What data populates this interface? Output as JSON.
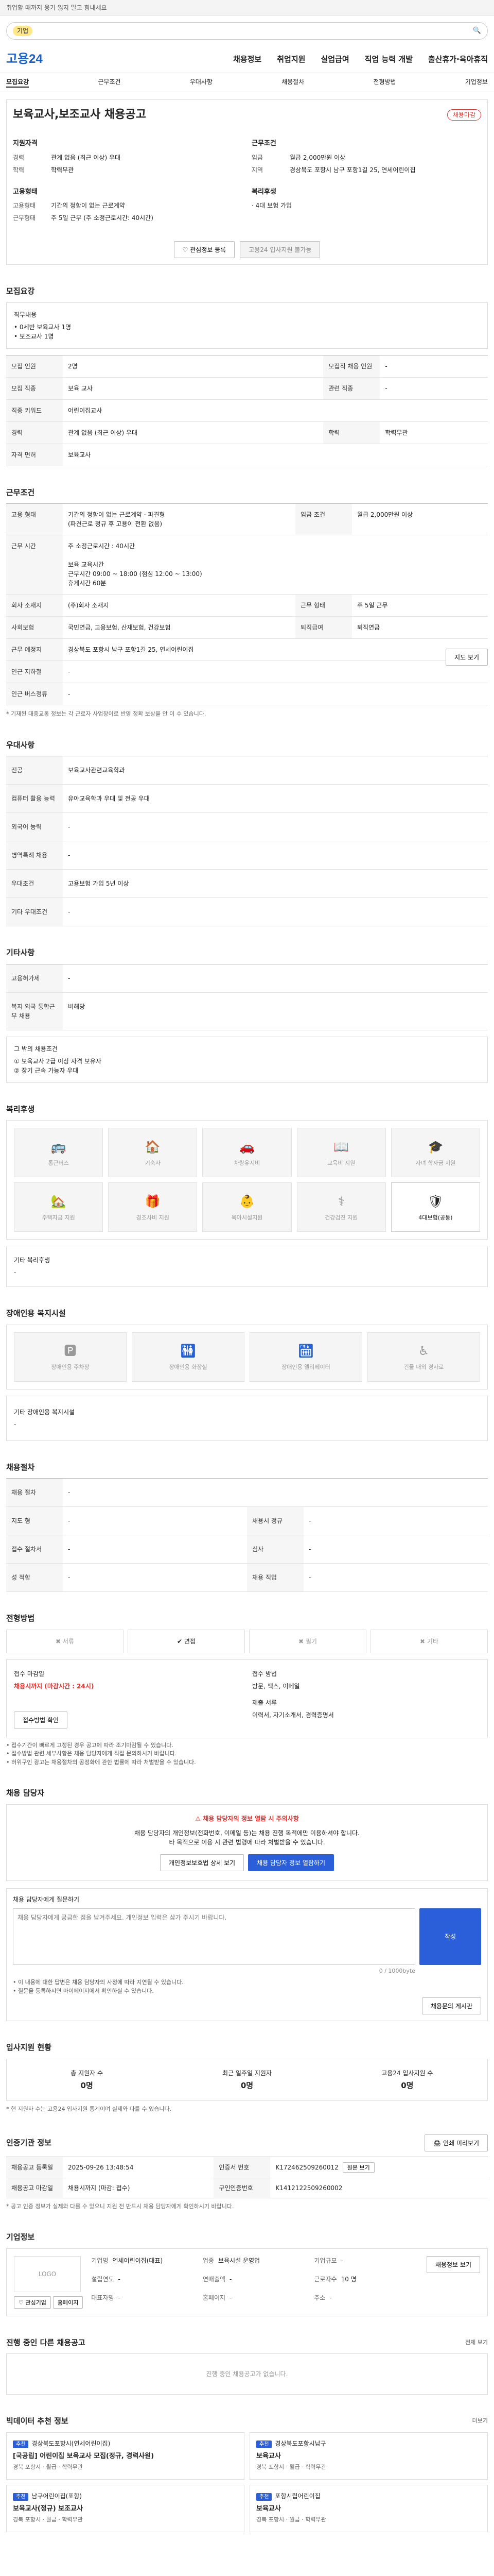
{
  "notice": "취업할 때까지 용기 잃지 말고 힘내세요",
  "search": {
    "tag": "기업",
    "placeholder": ""
  },
  "logo": "고용24",
  "gnb": [
    "채용정보",
    "취업지원",
    "실업급여",
    "직업 능력 개발",
    "출산휴가·육아휴직"
  ],
  "tabs": [
    "모집요강",
    "근무조건",
    "우대사항",
    "채용절차",
    "전형방법",
    "기업정보"
  ],
  "summary": {
    "title": "보육교사,보조교사 채용공고",
    "badge": "채용마감",
    "recruit_heading": "지원자격",
    "work_heading": "근무조건",
    "recruit_rows": [
      {
        "k": "경력",
        "v": "관계 없음 (최근 이상) 우대"
      },
      {
        "k": "학력",
        "v": "학력무관"
      }
    ],
    "work_rows": [
      {
        "k": "임금",
        "v": "월급 2,000만원 이상"
      },
      {
        "k": "지역",
        "v": "경상북도 포항시 남구 포항1길 25, 연세어린이집"
      }
    ],
    "form_heading": "고용형태",
    "form_rows": [
      {
        "k": "고용형태",
        "v": "기간의 정함이 없는 근로계약"
      },
      {
        "k": "근무형태",
        "v": "주 5일 근무 (주 소정근로시간: 40시간)"
      }
    ],
    "welfare_heading": "복리후생",
    "welfare_value": "· 4대 보험 가입",
    "interest_button": "관심정보 등록",
    "apply_button": "고용24 입사지원 불가능"
  },
  "recruit": {
    "title": "모집요강",
    "duty_label": "직무내용",
    "duties": [
      "• 0세반 보육교사 1명",
      "• 보조교사 1명"
    ],
    "rows": [
      {
        "k": "모집 인원",
        "v": "2명",
        "k2": "모집직 채용 인원",
        "v2": "-"
      },
      {
        "k": "모집 직종",
        "v": "보육 교사",
        "k2": "관련 직종",
        "v2": "-"
      },
      {
        "k": "직종 키워드",
        "v": "어린이집교사",
        "k2": "",
        "v2": ""
      },
      {
        "k": "경력",
        "v": "관계 없음 (최근 이상) 우대",
        "k2": "학력",
        "v2": "학력무관"
      },
      {
        "k": "자격 면허",
        "v": "보육교사",
        "k2": "",
        "v2": ""
      }
    ]
  },
  "work": {
    "title": "근무조건",
    "rows": [
      {
        "k": "고용 형태",
        "v": "기간의 정함이 없는 근로계약 · 파견형\n(파견근로 정규 후 고용이 전환 없음)",
        "k2": "임금 조건",
        "v2": "월급 2,000만원 이상"
      },
      {
        "k": "근무 시간",
        "v": "주 소정근로시간 : 40시간\n\n보육 교육시간\n근무시간 09:00 ~ 18:00 (점심 12:00 ~ 13:00)\n휴게시간 60분",
        "k2": "",
        "v2": ""
      },
      {
        "k": "회사 소재지",
        "v": "(주)회사 소재지",
        "k2": "근무 형태",
        "v2": "주 5일 근무"
      },
      {
        "k": "사회보험",
        "v": "국민연금, 고용보험, 산재보험, 건강보험",
        "k2": "퇴직급여",
        "v2": "퇴직연금"
      },
      {
        "k": "근무 예정지",
        "v": "경상북도 포항시 남구 포항1길 25, 연세어린이집",
        "k2": "",
        "v2": ""
      },
      {
        "k": "인근 지하철",
        "v": "-",
        "k2": "",
        "v2": ""
      },
      {
        "k": "인근 버스정류",
        "v": "-",
        "k2": "",
        "v2": ""
      }
    ],
    "map_button": "지도 보기",
    "note": "* 기재된 대중교통 정보는 각 근로자 사업장이로 반영 정확 보상을 안 이 수 있습니다."
  },
  "pref": {
    "title": "우대사항",
    "rows": [
      {
        "k": "전공",
        "v": "보육교사관련교육학과"
      },
      {
        "k": "컴퓨터 활용 능력",
        "v": "유아교육학과 우대 및 전공 우대"
      },
      {
        "k": "외국어 능력",
        "v": "-"
      },
      {
        "k": "병역특례 채용",
        "v": "-"
      },
      {
        "k": "우대조건",
        "v": "고용보험 가입 5년 이상"
      },
      {
        "k": "기타 우대조건",
        "v": "-"
      }
    ]
  },
  "etc": {
    "title": "기타사항",
    "rows": [
      {
        "k": "고용허가제",
        "v": "-"
      },
      {
        "k": "복지 외국 통합근무 채용",
        "v": "비해당"
      }
    ],
    "notes_title": "그 밖의 채용조건",
    "notes": [
      "① 보육교사 2급 이상 자격 보유자",
      "② 장기 근속 가능자 우대"
    ]
  },
  "welfare": {
    "title": "복리후생",
    "items": [
      "통근버스",
      "기숙사",
      "차량유지비",
      "교육비 지원",
      "자녀 학자금 지원",
      "주택자금 지원",
      "경조사비 지원",
      "육아시설지원",
      "건강검진 지원",
      "4대보험(공통)"
    ],
    "other_title": "기타 복리후생",
    "other_value": "-"
  },
  "disabled": {
    "title": "장애인용 복지시설",
    "items": [
      "장애인용 주차장",
      "장애인용 화장실",
      "장애인용 엘리베이터",
      "건물 내외 경사로"
    ],
    "other_title": "기타 장애인용 복지시설",
    "other_value": "-"
  },
  "process": {
    "title": "채용절차",
    "rows": [
      {
        "k": "채용 절차",
        "v": "-",
        "k2": "",
        "v2": ""
      },
      {
        "k": "지도 형",
        "v": "-",
        "k2": "채용시 정규",
        "v2": "-"
      },
      {
        "k": "접수 절차서",
        "v": "-",
        "k2": "심사",
        "v2": "-"
      },
      {
        "k": "성 적합",
        "v": "-",
        "k2": "채용 직업",
        "v2": "-"
      }
    ]
  },
  "method": {
    "title": "전형방법",
    "items": [
      "서류",
      "면접",
      "필기",
      "기타"
    ],
    "active": [
      false,
      true,
      false,
      false
    ],
    "period_label": "접수 마감일",
    "period_value": "채용시까지 (마감시간 : 24시)",
    "way_label": "접수 방법",
    "way_value": "방문, 팩스, 이메일",
    "address_label": "제출 서류",
    "address_value": "이력서, 자기소개서, 경력증명서",
    "check_button": "접수방법 확인",
    "notes": [
      "• 접수기간이 빠르게 고정된 경우 공고에 따라 조기마감될 수 있습니다.",
      "• 접수방법 관련 세부사항은 채용 담당자에게 직접 문의하시기 바랍니다.",
      "• 허위구인 광고는 채용절차의 공정화에 관한 법률에 따라 처벌받을 수 있습니다."
    ]
  },
  "contact": {
    "title": "채용 담당자",
    "warn": "채용 담당자의 정보 열람 시 주의사항",
    "body": "채용 담당자의 개인정보(전화번호, 이메일 등)는 채용 진행 목적에만 이용하셔야 합니다.",
    "body2": "타 목적으로 이용 시 관련 법령에 따라 처벌받을 수 있습니다.",
    "btn_privacy": "개인정보보호법 상세 보기",
    "btn_view": "채용 담당자 정보 열람하기",
    "qa_label": "채용 담당자에게 질문하기",
    "qa_placeholder": "채용 담당자에게 궁금한 점을 남겨주세요. 개인정보 입력은 삼가 주시기 바랍니다.",
    "qa_count": "0 / 1000byte",
    "qa_submit": "작성",
    "qa_notes": [
      "• 이 내용에 대한 답변은 채용 담당자의 사정에 따라 지연될 수 있습니다.",
      "• 질문을 등록하시면 마이페이지에서 확인하실 수 있습니다."
    ],
    "qa_more": "채용문의 게시판"
  },
  "stats": {
    "title": "입사지원 현황",
    "items": [
      {
        "k": "총 지원자 수",
        "v": "0명"
      },
      {
        "k": "최근 일주일 지원자",
        "v": "0명"
      },
      {
        "k": "고용24 입사지원 수",
        "v": "0명"
      }
    ],
    "note": "* 현 지원자 수는 고용24 입사지원 통계이며 실제와 다를 수 있습니다."
  },
  "posting": {
    "title": "인증기관 정보",
    "print_button": "인쇄 미리보기",
    "rows": [
      {
        "k": "채용공고 등록일",
        "v": "2025-09-26 13:48:54",
        "k2": "인증서 번호",
        "v2": "K172462509260012",
        "tag": "원본 보기"
      },
      {
        "k": "채용공고 마감일",
        "v": "채용시까지 (마감: 접수)",
        "k2": "구인인증번호",
        "v2": "K1412122509260002"
      }
    ],
    "note": "* 공고 인증 정보가 실제와 다를 수 있으니 지원 전 반드시 채용 담당자에게 확인하시기 바랍니다."
  },
  "company": {
    "title": "기업정보",
    "logo_text": "LOGO",
    "btn_like": "관심기업",
    "btn_home": "홈페이지",
    "rows": [
      {
        "k": "기업명",
        "v": "연세어린이집(대표)"
      },
      {
        "k": "업종",
        "v": "보육시설 운영업"
      },
      {
        "k": "기업규모",
        "v": "-"
      },
      {
        "k": "설립연도",
        "v": "-"
      },
      {
        "k": "연매출액",
        "v": "-"
      },
      {
        "k": "근로자수",
        "v": "10 명"
      },
      {
        "k": "대표자명",
        "v": "-"
      },
      {
        "k": "홈페이지",
        "v": "-"
      },
      {
        "k": "주소",
        "v": "-"
      }
    ],
    "view_button": "채용정보 보기"
  },
  "other_posts": {
    "title": "진행 중인 다른 채용공고",
    "more": "전체 보기",
    "empty": "진행 중인 채용공고가 없습니다."
  },
  "recommend": {
    "title": "빅데이터 추천 정보",
    "more": "더보기",
    "items": [
      {
        "tag": "추천",
        "company": "경상북도포항시(연세어린이집)",
        "name": "[국공립] 어린이집 보육교사 모집(정규, 경력사원)",
        "meta": "경북 포항시 · 월급 · 학력무관"
      },
      {
        "tag": "추천",
        "company": "경상북도포항시남구",
        "name": "보육교사",
        "meta": "경북 포항시 · 월급 · 학력무관"
      },
      {
        "tag": "추천",
        "company": "남구어린이집(포항)",
        "name": "보육교사(정규) 보조교사",
        "meta": "경북 포항시 · 월급 · 학력무관"
      },
      {
        "tag": "추천",
        "company": "포항시립어린이집",
        "name": "보육교사",
        "meta": "경북 포항시 · 월급 · 학력무관"
      }
    ]
  }
}
